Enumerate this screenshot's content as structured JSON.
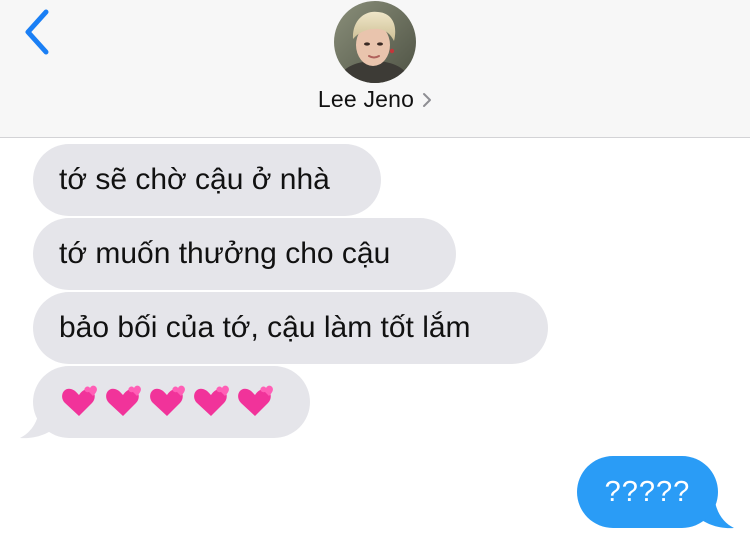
{
  "header": {
    "back_icon": "chevron-left-icon",
    "contact_name": "Lee Jeno",
    "detail_icon": "chevron-right-icon",
    "accent_color": "#1a7ff5"
  },
  "messages": [
    {
      "direction": "incoming",
      "text": "tớ sẽ chờ cậu ở nhà"
    },
    {
      "direction": "incoming",
      "text": "tớ muốn thưởng cho cậu"
    },
    {
      "direction": "incoming",
      "text": "bảo bối của tớ, cậu làm tốt lắm"
    },
    {
      "direction": "incoming",
      "emoji": "two-hearts-emoji",
      "count": 5
    },
    {
      "direction": "outgoing",
      "text": "?????"
    }
  ],
  "colors": {
    "incoming_bubble": "#e5e5ea",
    "outgoing_bubble": "#2a9cf6",
    "header_bg": "#f7f7f7"
  }
}
